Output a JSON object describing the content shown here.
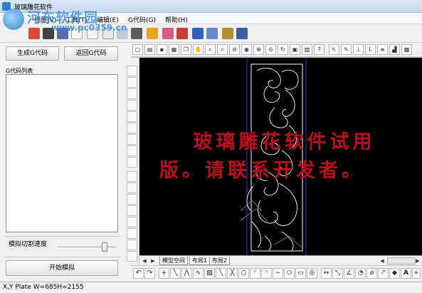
{
  "window": {
    "title": "玻璃雕花软件"
  },
  "menu": {
    "items": [
      "视图(V)",
      "工具(T)",
      "编辑(E)",
      "G代码(G)",
      "帮助(H)"
    ]
  },
  "watermark": {
    "site": "河东软件园",
    "url": "www.pc0359.cn"
  },
  "left_panel": {
    "generate_button": "生成G代码",
    "back_button": "返回G代码",
    "list_label": "G代码列表",
    "speed_label": "模拟切割速度",
    "speed_level": 0.85,
    "start_button": "开始模拟"
  },
  "canvas": {
    "trial_line1": "玻璃雕花软件试用",
    "trial_line2": "版。请联系开发者。"
  },
  "tabs": {
    "items": [
      "模型空间",
      "布局1",
      "布局2"
    ]
  },
  "toolbar2": {
    "text_buttons": [
      "L",
      "A"
    ]
  },
  "status": {
    "text": "X,Y  Plate W=685H=2155"
  },
  "colors": {
    "canvas_bg": "#000000",
    "trial_text": "#b7101a",
    "pattern": "#ffffff",
    "guide": "#2a36c8"
  }
}
